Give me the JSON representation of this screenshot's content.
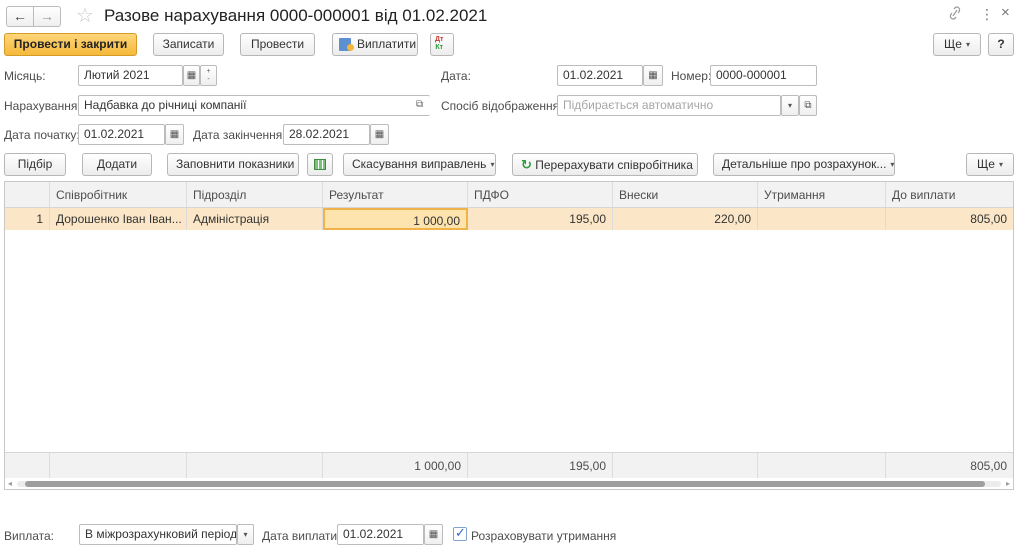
{
  "window": {
    "title": "Разове нарахування 0000-000001 від 01.02.2021",
    "back_icon": "arrow-left",
    "forward_icon": "arrow-right",
    "star_icon": "star",
    "link_icon": "chain-link",
    "more_icon": "⋮",
    "close_icon": "×"
  },
  "toolbar": {
    "post_close": "Провести і закрити",
    "save": "Записати",
    "post": "Провести",
    "pay": "Виплатити",
    "dtkt_icon": "Дт/Кт",
    "more": "Ще",
    "help": "?"
  },
  "form": {
    "month_label": "Місяць:",
    "month_value": "Лютий 2021",
    "date_label": "Дата:",
    "date_value": "01.02.2021",
    "number_label": "Номер:",
    "number_value": "0000-000001",
    "accrual_label": "Нарахування:",
    "accrual_value": "Надбавка до річниці компанії",
    "display_method_label": "Спосіб відображення:",
    "display_method_placeholder": "Підбирається автоматично",
    "start_date_label": "Дата початку:",
    "start_date_value": "01.02.2021",
    "end_date_label": "Дата закінчення:",
    "end_date_value": "28.02.2021"
  },
  "table_toolbar": {
    "pick": "Підбір",
    "add": "Додати",
    "fill": "Заповнити показники",
    "cancel_corrections": "Скасування виправлень",
    "recalc": "Перерахувати співробітника",
    "details": "Детальніше про розрахунок...",
    "more": "Ще"
  },
  "table": {
    "columns": [
      "Співробітник",
      "Підрозділ",
      "Результат",
      "ПДФО",
      "Внески",
      "Утримання",
      "До виплати"
    ],
    "rows": [
      {
        "n": "1",
        "employee": "Дорошенко Іван Іван...",
        "department": "Адміністрація",
        "result": "1 000,00",
        "pdfo": "195,00",
        "contrib": "220,00",
        "deduct": "",
        "payout": "805,00"
      }
    ],
    "totals": {
      "result": "1 000,00",
      "pdfo": "195,00",
      "contrib": "",
      "deduct": "",
      "payout": "805,00"
    }
  },
  "footer": {
    "payment_label": "Виплата:",
    "payment_value": "В міжрозрахунковий період",
    "pay_date_label": "Дата виплати:",
    "pay_date_value": "01.02.2021",
    "calc_deductions_label": "Розраховувати утримання",
    "calc_deductions_checked": true
  },
  "colors": {
    "primary_button": "#f5b93a",
    "selected_row": "#fbe7c7",
    "checkbox_accent": "#2a69c4",
    "recalc_icon": "#2e9b3a"
  }
}
